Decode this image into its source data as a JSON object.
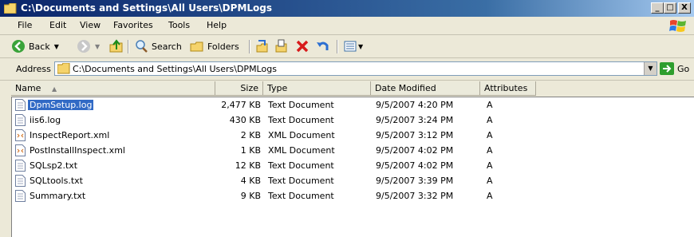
{
  "window": {
    "title": "C:\\Documents and Settings\\All Users\\DPMLogs"
  },
  "title_buttons": [
    "_",
    "□",
    "X"
  ],
  "menu": [
    "File",
    "Edit",
    "View",
    "Favorites",
    "Tools",
    "Help"
  ],
  "toolbar": {
    "back_label": "Back",
    "search_label": "Search",
    "folders_label": "Folders"
  },
  "address": {
    "label": "Address",
    "value": "C:\\Documents and Settings\\All Users\\DPMLogs",
    "go_label": "Go"
  },
  "columns": [
    "Name",
    "Size",
    "Type",
    "Date Modified",
    "Attributes"
  ],
  "files": [
    {
      "name": "DpmSetup.log",
      "size": "2,477 KB",
      "type": "Text Document",
      "modified": "9/5/2007 4:20 PM",
      "attributes": "A",
      "icon": "text-file-icon",
      "selected": true
    },
    {
      "name": "iis6.log",
      "size": "430 KB",
      "type": "Text Document",
      "modified": "9/5/2007 3:24 PM",
      "attributes": "A",
      "icon": "text-file-icon"
    },
    {
      "name": "InspectReport.xml",
      "size": "2 KB",
      "type": "XML Document",
      "modified": "9/5/2007 3:12 PM",
      "attributes": "A",
      "icon": "xml-file-icon"
    },
    {
      "name": "PostInstallInspect.xml",
      "size": "1 KB",
      "type": "XML Document",
      "modified": "9/5/2007 4:02 PM",
      "attributes": "A",
      "icon": "xml-file-icon"
    },
    {
      "name": "SQLsp2.txt",
      "size": "12 KB",
      "type": "Text Document",
      "modified": "9/5/2007 4:02 PM",
      "attributes": "A",
      "icon": "text-file-icon"
    },
    {
      "name": "SQLtools.txt",
      "size": "4 KB",
      "type": "Text Document",
      "modified": "9/5/2007 3:39 PM",
      "attributes": "A",
      "icon": "text-file-icon"
    },
    {
      "name": "Summary.txt",
      "size": "9 KB",
      "type": "Text Document",
      "modified": "9/5/2007 3:32 PM",
      "attributes": "A",
      "icon": "text-file-icon"
    }
  ],
  "colors": {
    "title_bar": "#0a246a",
    "selection": "#316ac5",
    "window_bg": "#ece9d8"
  }
}
